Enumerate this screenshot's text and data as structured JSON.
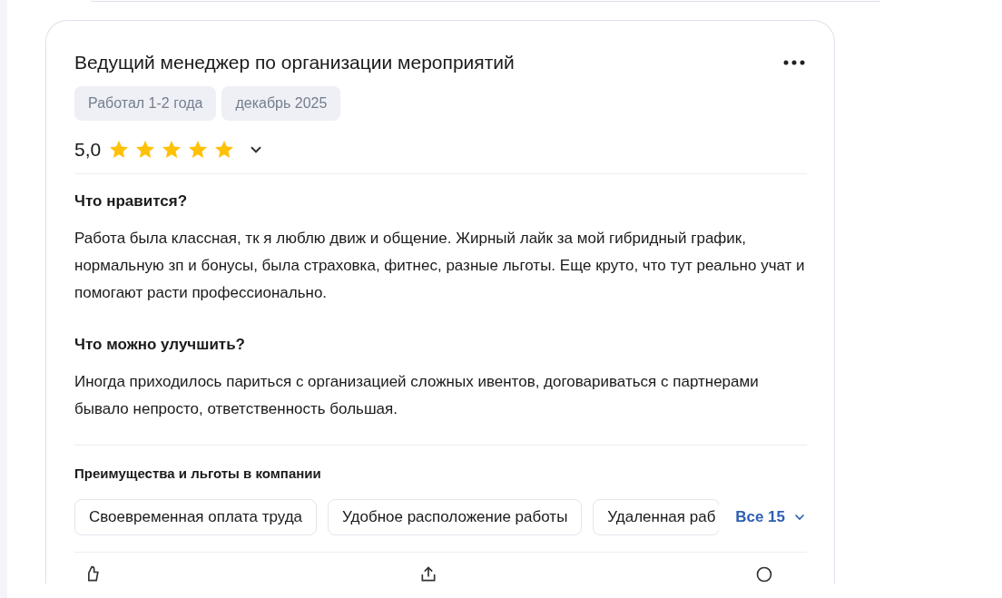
{
  "review": {
    "title": "Ведущий менеджер по организации мероприятий",
    "tags": [
      "Работал 1-2 года",
      "декабрь 2025"
    ],
    "rating": {
      "value": "5,0",
      "stars": 5,
      "expanded": false
    },
    "sections": [
      {
        "heading": "Что нравится?",
        "text": "Работа была классная, тк я люблю движ и общение. Жирный лайк за мой гибридный график, нормальную зп и бонусы, была страховка, фитнес, разные льготы. Еще круто, что тут реально учат и помогают расти профессионально."
      },
      {
        "heading": "Что можно улучшить?",
        "text": "Иногда приходилось париться с организацией сложных ивентов, договариваться с партнерами бывало непросто, ответственность большая."
      }
    ],
    "benefits": {
      "heading": "Преимущества и льготы в компании",
      "items": [
        "Своевременная оплата труда",
        "Удобное расположение работы",
        "Удаленная раб"
      ],
      "more": "Все 15"
    }
  }
}
